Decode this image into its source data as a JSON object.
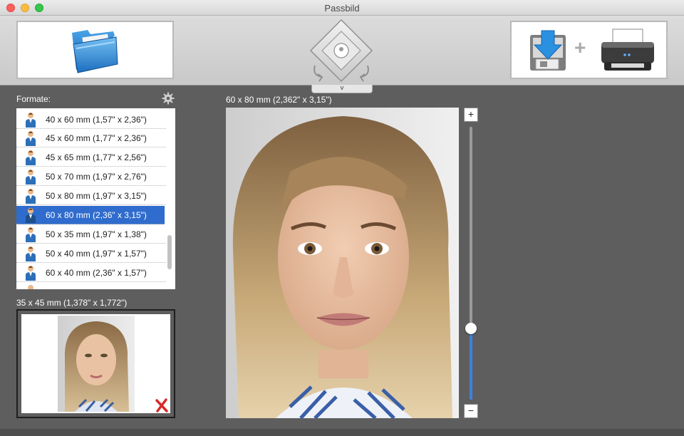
{
  "window": {
    "title": "Passbild"
  },
  "toolbar": {
    "open_icon": "folder-icon",
    "nav_icon": "position-pad-icon",
    "nav_toggle_label": "v",
    "save_icon": "save-download-icon",
    "plus_label": "+",
    "print_icon": "printer-icon"
  },
  "formats": {
    "label": "Formate:",
    "items": [
      {
        "label": "40 x 60 mm (1,57\" x 2,36\")"
      },
      {
        "label": "45 x 60 mm (1,77\" x 2,36\")"
      },
      {
        "label": "45 x 65 mm (1,77\" x 2,56\")"
      },
      {
        "label": "50 x 70 mm (1,97\" x 2,76\")"
      },
      {
        "label": "50 x 80 mm (1,97\" x 3,15\")"
      },
      {
        "label": "60 x 80 mm (2,36\" x 3,15\")"
      },
      {
        "label": "50 x 35 mm (1,97\" x 1,38\")"
      },
      {
        "label": "50 x 40 mm (1,97\" x 1,57\")"
      },
      {
        "label": "60 x 40 mm (2,36\" x 1,57\")"
      }
    ],
    "selected_index": 5
  },
  "preview": {
    "label": "35 x 45 mm (1,378\" x 1,772\")"
  },
  "main": {
    "label": "60 x 80 mm (2,362\" x 3,15\")",
    "zoom_in_label": "+",
    "zoom_out_label": "−",
    "zoom_level": 0.26
  },
  "colors": {
    "selection": "#2f6ccd",
    "slider_fill": "#3b82dd",
    "background": "#5e5e5e"
  }
}
